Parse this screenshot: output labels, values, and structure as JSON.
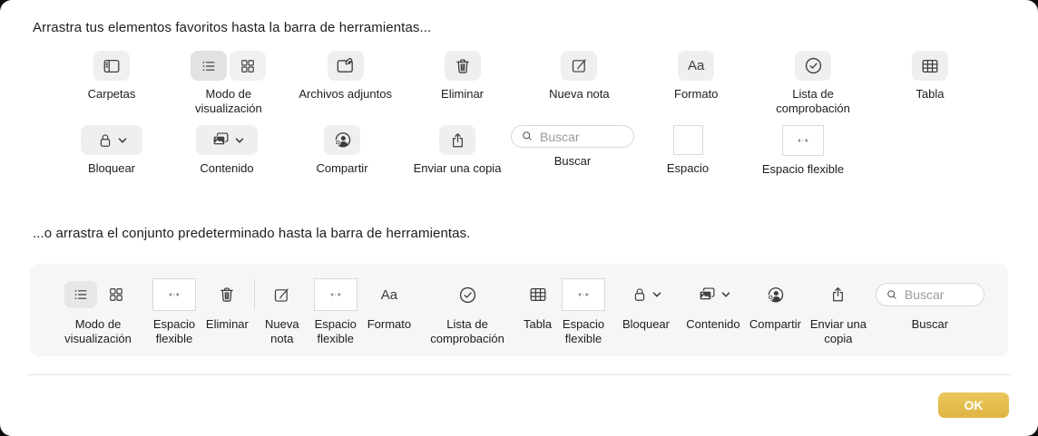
{
  "instructions": {
    "favorites_line": "Arrastra tus elementos favoritos hasta la barra de herramientas...",
    "default_line": "...o arrastra el conjunto predeterminado hasta la barra de herramientas."
  },
  "icons": {
    "format_glyph": "Aa"
  },
  "colors": {
    "accent_gold": "#e3ba49",
    "tile_gray": "#efefef",
    "tile_selected": "#e2e2e2",
    "bar_background": "#f6f6f6",
    "glyph": "#3c3c3c"
  },
  "favorites": {
    "row1": [
      {
        "id": "carpetas",
        "icon": "sidebar",
        "label": "Carpetas"
      },
      {
        "id": "modo-de-visualizacion",
        "icon": "view-segmented",
        "label": "Modo de visualización"
      },
      {
        "id": "archivos-adjuntos",
        "icon": "attachments",
        "label": "Archivos adjuntos"
      },
      {
        "id": "eliminar",
        "icon": "trash",
        "label": "Eliminar"
      },
      {
        "id": "nueva-nota",
        "icon": "compose",
        "label": "Nueva nota"
      },
      {
        "id": "formato",
        "icon": "format",
        "label": "Formato"
      },
      {
        "id": "lista-de-comprobacion",
        "icon": "checklist",
        "label": "Lista de comprobación"
      },
      {
        "id": "tabla",
        "icon": "table",
        "label": "Tabla"
      }
    ],
    "row2": [
      {
        "id": "bloquear",
        "icon": "lock",
        "label": "Bloquear",
        "chevron": true
      },
      {
        "id": "contenido",
        "icon": "media",
        "label": "Contenido",
        "chevron": true
      },
      {
        "id": "compartir",
        "icon": "share-person",
        "label": "Compartir"
      },
      {
        "id": "enviar-una-copia",
        "icon": "export",
        "label": "Enviar una copia"
      },
      {
        "id": "buscar",
        "icon": "search-field",
        "label": "Buscar",
        "placeholder": "Buscar"
      },
      {
        "id": "espacio",
        "icon": "space",
        "label": "Espacio"
      },
      {
        "id": "espacio-flexible",
        "icon": "flex-space",
        "label": "Espacio flexible"
      }
    ]
  },
  "default_set": {
    "items": [
      {
        "id": "modo-de-visualizacion",
        "icon": "view-segmented",
        "label": "Modo de visualización"
      },
      {
        "id": "espacio-flexible",
        "icon": "flex-space",
        "label": "Espacio flexible"
      },
      {
        "id": "eliminar",
        "icon": "trash",
        "label": "Eliminar"
      },
      {
        "id": "espacio-separador",
        "icon": "separator",
        "label": ""
      },
      {
        "id": "nueva-nota",
        "icon": "compose",
        "label": "Nueva nota"
      },
      {
        "id": "espacio-flexible",
        "icon": "flex-space",
        "label": "Espacio flexible"
      },
      {
        "id": "formato",
        "icon": "format",
        "label": "Formato"
      },
      {
        "id": "lista-de-comprobacion",
        "icon": "checklist",
        "label": "Lista de comprobación"
      },
      {
        "id": "tabla",
        "icon": "table",
        "label": "Tabla"
      },
      {
        "id": "espacio-flexible",
        "icon": "flex-space",
        "label": "Espacio flexible"
      },
      {
        "id": "bloquear",
        "icon": "lock",
        "label": "Bloquear",
        "chevron": true
      },
      {
        "id": "contenido",
        "icon": "media",
        "label": "Contenido",
        "chevron": true
      },
      {
        "id": "compartir",
        "icon": "share-person",
        "label": "Compartir"
      },
      {
        "id": "enviar-una-copia",
        "icon": "export",
        "label": "Enviar una copia"
      },
      {
        "id": "buscar",
        "icon": "search-field",
        "label": "Buscar",
        "placeholder": "Buscar"
      }
    ]
  },
  "footer": {
    "ok_label": "OK"
  }
}
